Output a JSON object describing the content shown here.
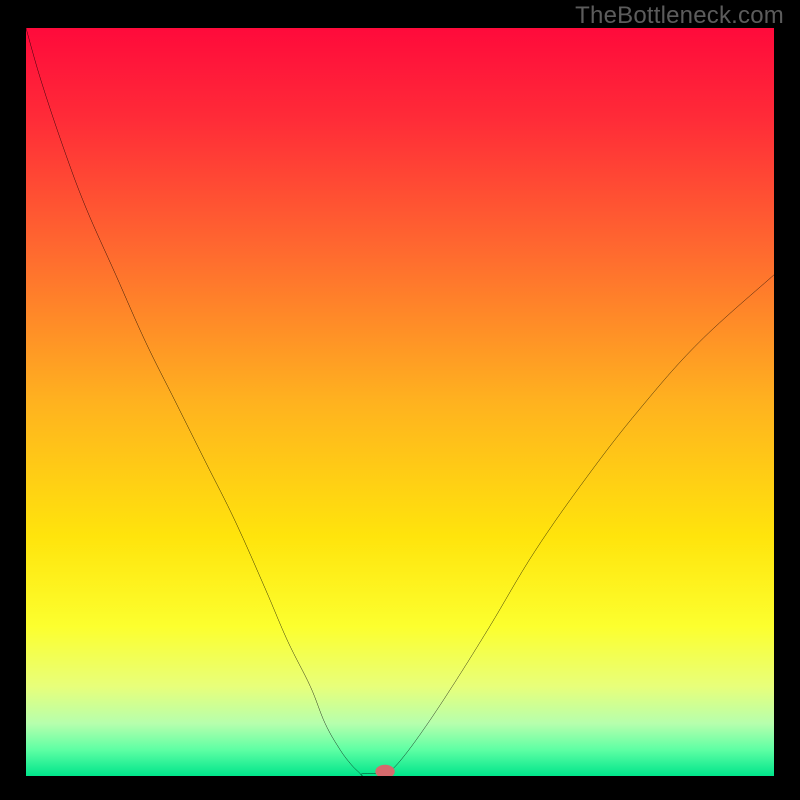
{
  "watermark": "TheBottleneck.com",
  "chart_data": {
    "type": "line",
    "title": "",
    "xlabel": "",
    "ylabel": "",
    "xlim": [
      0,
      100
    ],
    "ylim": [
      0,
      100
    ],
    "grid": false,
    "legend": false,
    "background_gradient": {
      "type": "vertical",
      "stops": [
        {
          "pos": 0.0,
          "color": "#ff0a3b"
        },
        {
          "pos": 0.12,
          "color": "#ff2b38"
        },
        {
          "pos": 0.3,
          "color": "#ff6a2f"
        },
        {
          "pos": 0.5,
          "color": "#ffb21f"
        },
        {
          "pos": 0.68,
          "color": "#ffe40c"
        },
        {
          "pos": 0.8,
          "color": "#fcff2e"
        },
        {
          "pos": 0.88,
          "color": "#e8ff7a"
        },
        {
          "pos": 0.93,
          "color": "#b6ffad"
        },
        {
          "pos": 0.965,
          "color": "#5effa4"
        },
        {
          "pos": 1.0,
          "color": "#00e58b"
        }
      ]
    },
    "series": [
      {
        "name": "left-branch",
        "x": [
          0,
          2,
          5,
          8,
          12,
          16,
          20,
          24,
          28,
          32,
          35,
          38,
          40,
          42,
          43.5,
          44.5,
          45
        ],
        "y": [
          100,
          93,
          84,
          76,
          67,
          58,
          50,
          42,
          34,
          25,
          18,
          12,
          7,
          3.5,
          1.5,
          0.5,
          0
        ]
      },
      {
        "name": "flat-min",
        "x": [
          45,
          48
        ],
        "y": [
          0.3,
          0.3
        ]
      },
      {
        "name": "right-branch",
        "x": [
          48,
          50,
          53,
          57,
          62,
          68,
          75,
          82,
          90,
          100
        ],
        "y": [
          0,
          2,
          6,
          12,
          20,
          30,
          40,
          49,
          58,
          67
        ]
      }
    ],
    "marker": {
      "name": "optimal-point",
      "x": 48,
      "y": 0.6,
      "color": "#d66a6d",
      "rx": 1.3,
      "ry": 0.9
    },
    "curve_stroke": "#000000",
    "curve_width": 3
  }
}
